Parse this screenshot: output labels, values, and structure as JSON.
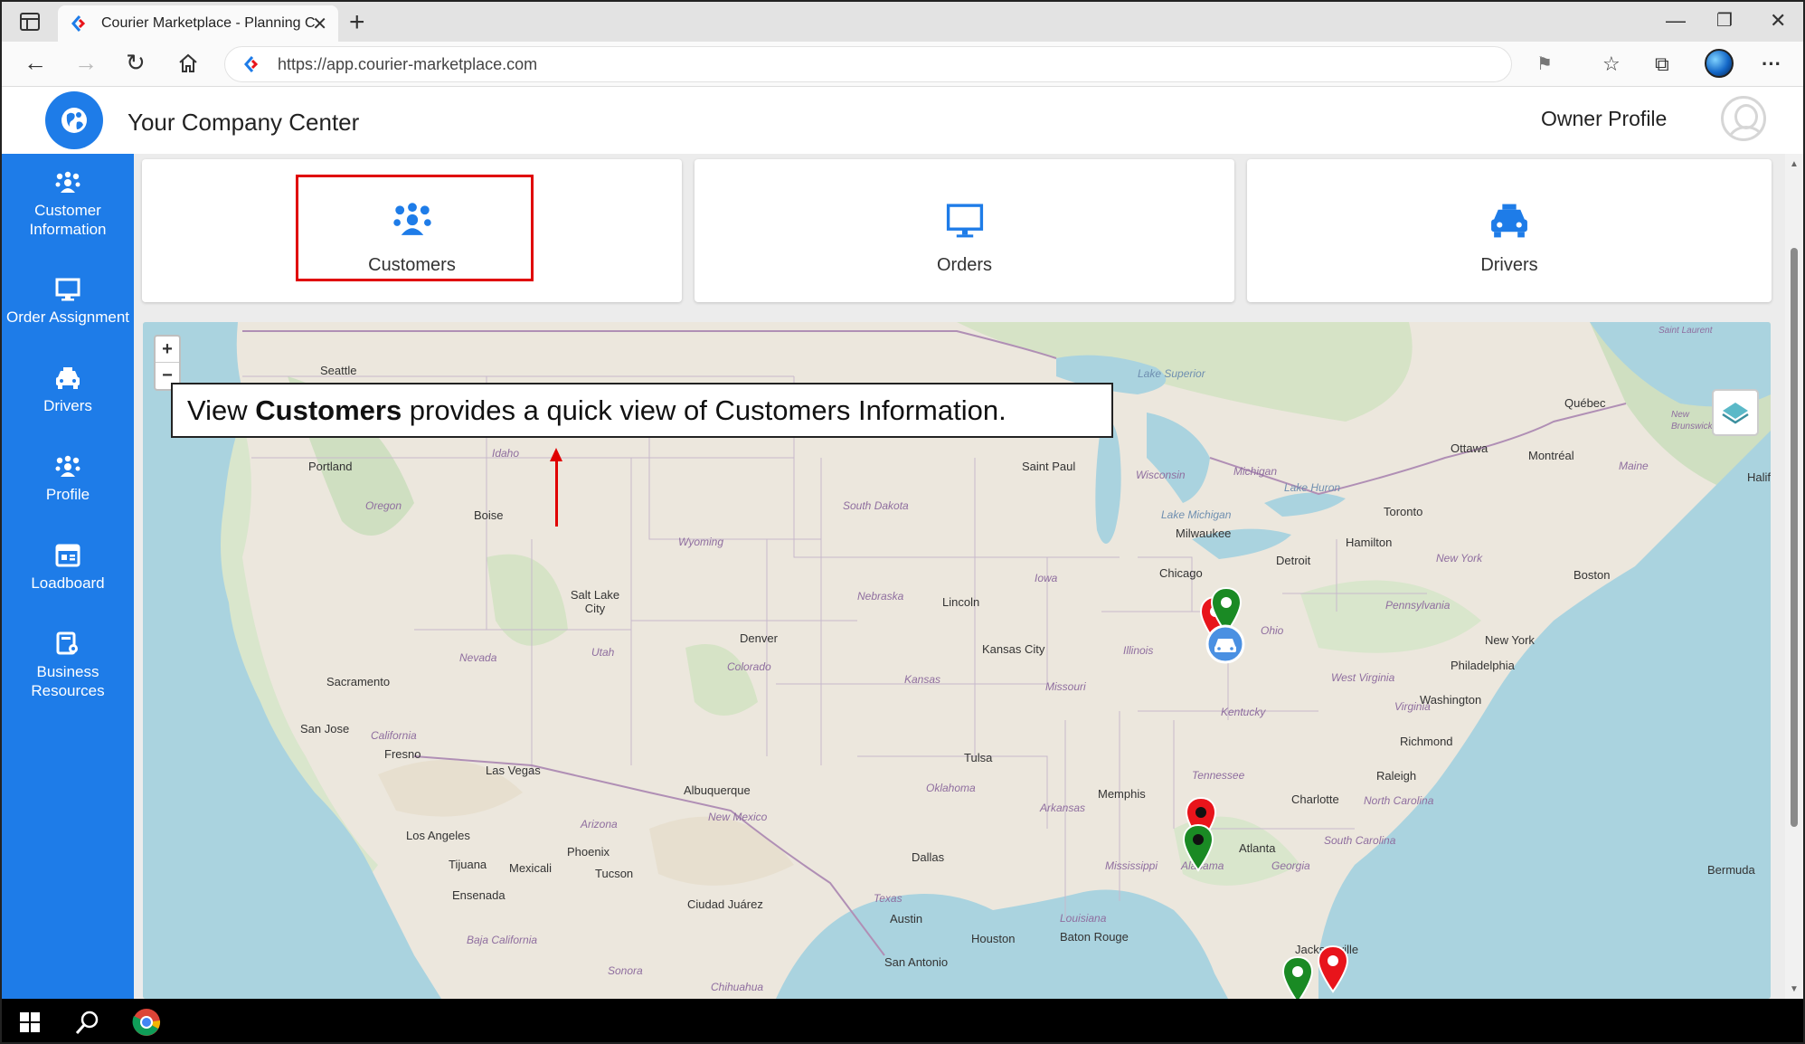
{
  "browser": {
    "tab_title": "Courier Marketplace - Planning C",
    "url": "https://app.courier-marketplace.com"
  },
  "header": {
    "company_title": "Your Company Center",
    "owner_profile": "Owner Profile"
  },
  "sidebar": {
    "items": [
      {
        "label": "Customer Information",
        "icon": "customers-icon"
      },
      {
        "label": "Order Assignment",
        "icon": "monitor-icon"
      },
      {
        "label": "Drivers",
        "icon": "car-icon"
      },
      {
        "label": "Profile",
        "icon": "customers-icon"
      },
      {
        "label": "Loadboard",
        "icon": "loadboard-icon"
      },
      {
        "label": "Business Resources",
        "icon": "business-icon"
      }
    ]
  },
  "tiles": [
    {
      "label": "Customers",
      "icon": "customers-icon"
    },
    {
      "label": "Orders",
      "icon": "monitor-icon"
    },
    {
      "label": "Drivers",
      "icon": "car-icon"
    }
  ],
  "callout": {
    "prefix": "View ",
    "bold": "Customers",
    "suffix": " provides a quick view of Customers Information."
  },
  "map": {
    "zoom_in": "+",
    "zoom_out": "−",
    "cities": [
      "Seattle",
      "Portland",
      "Boise",
      "Salt Lake City",
      "Sacramento",
      "San Jose",
      "Fresno",
      "Las Vegas",
      "Los Angeles",
      "Tijuana",
      "Mexicali",
      "Ensenada",
      "Phoenix",
      "Tucson",
      "Denver",
      "Albuquerque",
      "Ciudad Juárez",
      "Saint Paul",
      "Milwaukee",
      "Chicago",
      "Lincoln",
      "Kansas City",
      "Tulsa",
      "Dallas",
      "Austin",
      "Houston",
      "San Antonio",
      "Baton Rouge",
      "Memphis",
      "Atlanta",
      "Charlotte",
      "Raleigh",
      "Richmond",
      "Washington",
      "Philadelphia",
      "New York",
      "Boston",
      "Detroit",
      "Toronto",
      "Hamilton",
      "Ottawa",
      "Montréal",
      "Québec",
      "Halif",
      "Jacksonville",
      "Bermuda"
    ],
    "regions": [
      "Oregon",
      "Idaho",
      "Nevada",
      "California",
      "Utah",
      "Arizona",
      "Wyoming",
      "Colorado",
      "New Mexico",
      "South Dakota",
      "Nebraska",
      "Kansas",
      "Oklahoma",
      "Texas",
      "Iowa",
      "Missouri",
      "Arkansas",
      "Louisiana",
      "Mississippi",
      "Alabama",
      "Tennessee",
      "Kentucky",
      "Illinois",
      "Ohio",
      "West Virginia",
      "Virginia",
      "North Carolina",
      "South Carolina",
      "Georgia",
      "Pennsylvania",
      "New York",
      "Wisconsin",
      "Michigan",
      "Maine",
      "Baja California",
      "Sonora",
      "Chihuahua",
      "New Brunswick",
      "Saint Laurent"
    ],
    "water": [
      "Lake Superior",
      "Lake Michigan",
      "Lake Huron"
    ]
  },
  "colors": {
    "brand_blue": "#1e7ce8",
    "highlight_red": "#e00000",
    "pin_red": "#e8141b",
    "pin_green": "#1a8a24"
  }
}
